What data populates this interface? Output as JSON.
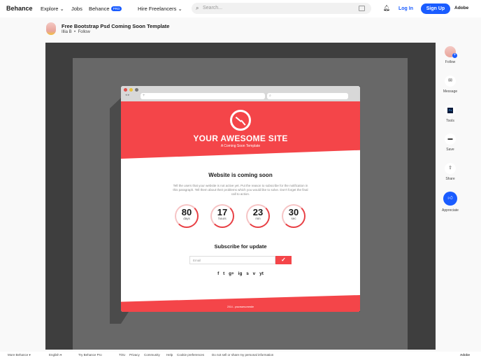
{
  "header": {
    "logo": "Behance",
    "explore": "Explore",
    "jobs": "Jobs",
    "behance": "Behance",
    "pro": "PRO",
    "hire": "Hire Freelancers",
    "search_placeholder": "Search...",
    "login": "Log In",
    "signup": "Sign Up",
    "adobe": "Adobe"
  },
  "project": {
    "title": "Free Bootstrap Psd Coming Soon Template",
    "author": "Illia B",
    "follow": "Follow"
  },
  "mock": {
    "site": "YOUR AWESOME SITE",
    "tagline": "A Coming Soon Template",
    "heading": "Website is coming soon",
    "paragraph": "Tell the users that your website is not active yet. Put the reason to subscribe for the notification in this paragraph. Tell them about their problems which you would like to solve. Don't forget the final call to action.",
    "countdown": [
      {
        "n": "80",
        "u": "days"
      },
      {
        "n": "17",
        "u": "hours"
      },
      {
        "n": "23",
        "u": "min"
      },
      {
        "n": "30",
        "u": "sec"
      }
    ],
    "subscribe": "Subscribe for update",
    "email_placeholder": "Email",
    "social": "f  t  g+  ig  s  v  yt",
    "footer": "2014 - yourawesomesite"
  },
  "sidebar": {
    "follow": "Follow",
    "message": "Message",
    "tools": "Tools",
    "save": "Save",
    "share": "Share",
    "appreciate": "Appreciate"
  },
  "footer": {
    "more": "More Behance ▾",
    "english": "English ▾",
    "try": "Try Behance Pro",
    "tou": "TOU",
    "privacy": "Privacy",
    "community": "Community",
    "help": "Help",
    "cookie": "Cookie preferences",
    "dns": "Do not sell or share my personal information",
    "adobe": "Adobe"
  }
}
